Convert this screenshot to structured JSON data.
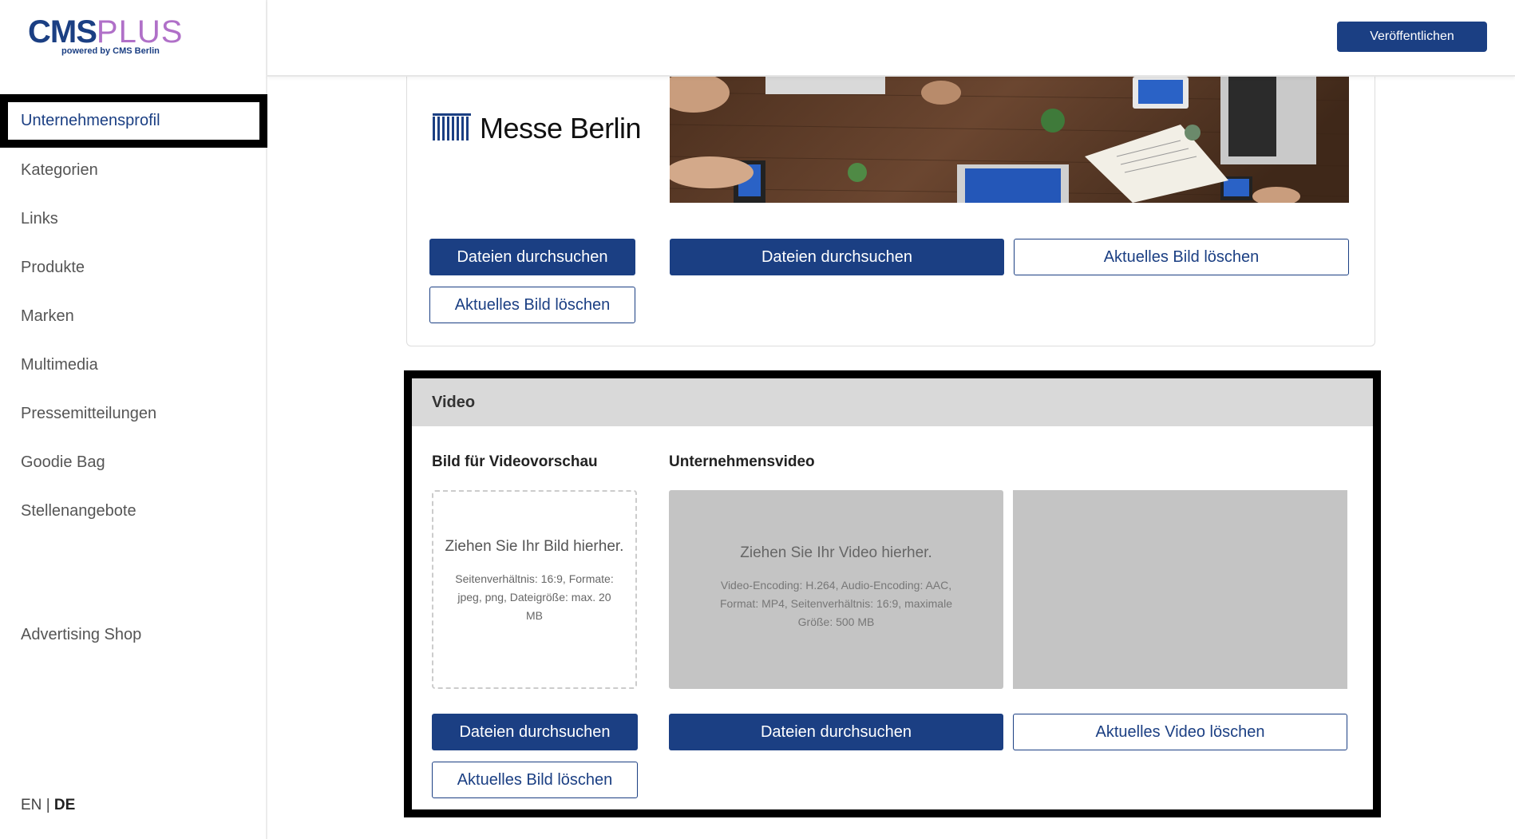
{
  "brand": {
    "logo_cms": "CMS",
    "logo_plus": "PLUS",
    "logo_sub": "powered by CMS Berlin",
    "primary_color": "#1b3f83"
  },
  "topbar": {
    "publish_label": "Veröffentlichen"
  },
  "sidebar": {
    "items": [
      {
        "label": "Unternehmensprofil",
        "active": true
      },
      {
        "label": "Kategorien"
      },
      {
        "label": "Links"
      },
      {
        "label": "Produkte"
      },
      {
        "label": "Marken"
      },
      {
        "label": "Multimedia"
      },
      {
        "label": "Pressemitteilungen"
      },
      {
        "label": "Goodie Bag"
      },
      {
        "label": "Stellenangebote"
      }
    ],
    "shop_label": "Advertising Shop",
    "lang": {
      "en": "EN",
      "sep": "|",
      "de": "DE"
    }
  },
  "upper_card": {
    "logo_text": "Messe Berlin",
    "browse_label": "Dateien durchsuchen",
    "delete_image_label": "Aktuelles Bild löschen"
  },
  "video": {
    "section_title": "Video",
    "preview_title": "Bild für Videovorschau",
    "company_video_title": "Unternehmensvideo",
    "img_drop_title": "Ziehen Sie Ihr Bild hierher.",
    "img_drop_desc": "Seitenverhältnis: 16:9, Formate: jpeg, png, Dateigröße: max. 20 MB",
    "vid_drop_title": "Ziehen Sie Ihr Video hierher.",
    "vid_drop_desc": "Video-Encoding: H.264, Audio-Encoding: AAC, Format: MP4, Seitenverhältnis: 16:9, maximale Größe: 500 MB",
    "browse_label": "Dateien durchsuchen",
    "delete_image_label": "Aktuelles Bild löschen",
    "delete_video_label": "Aktuelles Video löschen"
  }
}
